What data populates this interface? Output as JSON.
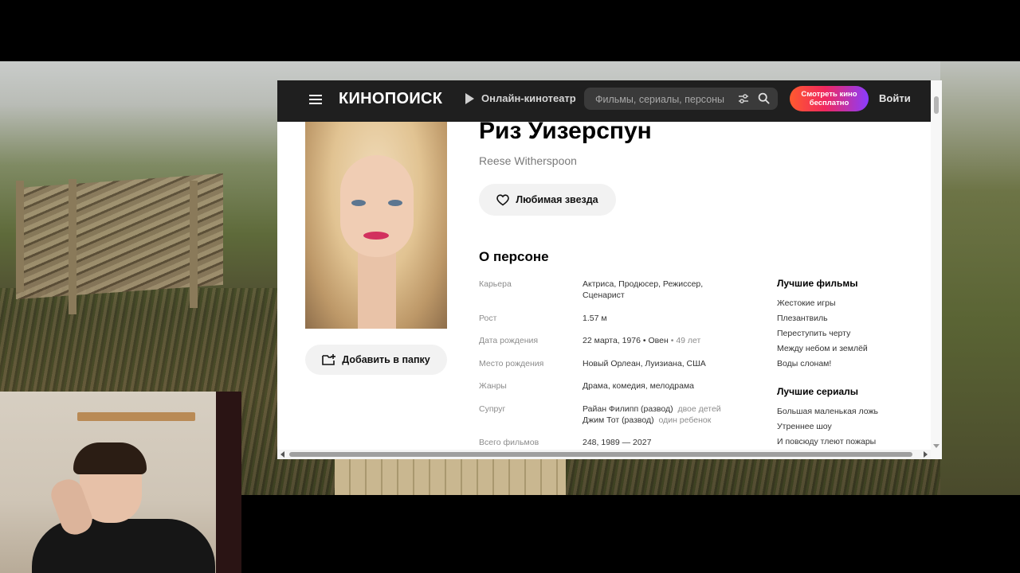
{
  "header": {
    "logo": "КИНОПОИСК",
    "online_cinema": "Онлайн-кинотеатр",
    "search_placeholder": "Фильмы, сериалы, персоны",
    "watch_button": "Смотреть кино бесплатно",
    "login": "Войти"
  },
  "person": {
    "name_ru": "Риз Уизерспун",
    "name_en": "Reese Witherspoon",
    "favorite_button": "Любимая звезда",
    "add_folder_button": "Добавить в папку"
  },
  "about": {
    "title": "О персоне",
    "career_label": "Карьера",
    "career_value": "Актриса, Продюсер, Режиссер, Сценарист",
    "height_label": "Рост",
    "height_value": "1.57 м",
    "birth_label": "Дата рождения",
    "birth_date": "22 марта, 1976",
    "birth_sign": "Овен",
    "birth_age": "49 лет",
    "birthplace_label": "Место рождения",
    "birthplace_value": "Новый Орлеан, Луизиана, США",
    "genres_label": "Жанры",
    "genres_value": "Драма, комедия, мелодрама",
    "spouse_label": "Супруг",
    "spouse_1_name": "Райан Филипп (развод)",
    "spouse_1_note": "двое детей",
    "spouse_2_name": "Джим Тот (развод)",
    "spouse_2_note": "один ребенок",
    "films_label": "Всего фильмов",
    "films_value": "248, 1989 — 2027"
  },
  "best_films": {
    "title": "Лучшие фильмы",
    "items": [
      "Жестокие игры",
      "Плезантвиль",
      "Переступить черту",
      "Между небом и землёй",
      "Воды слонам!"
    ]
  },
  "best_series": {
    "title": "Лучшие сериалы",
    "items": [
      "Большая маленькая ложь",
      "Утреннее шоу",
      "И повсюду тлеют пожары"
    ]
  },
  "colors": {
    "header_bg": "#1f1f1f",
    "button_gradient_start": "#ff5a2e",
    "button_gradient_end": "#8a3cff"
  }
}
